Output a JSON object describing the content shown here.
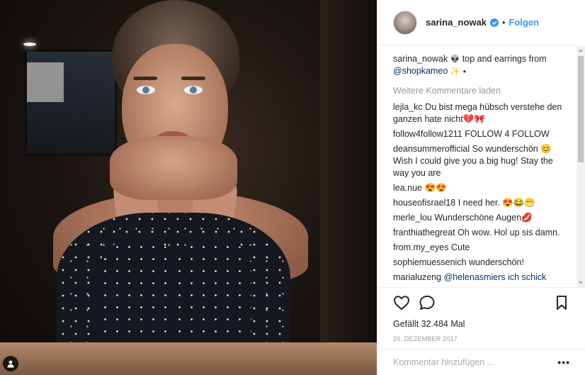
{
  "post": {
    "author": {
      "username": "sarina_nowak",
      "verified": true,
      "follow_label": "Folgen",
      "separator": "•"
    },
    "caption": {
      "username": "sarina_nowak",
      "emoji_alien": "👽",
      "text": " top and earrings from ",
      "mention": "@shopkameo",
      "trailing": " ✨ ⭑"
    },
    "load_more_label": "Weitere Kommentare laden",
    "comments": [
      {
        "username": "lejla_kc",
        "text": " Du bist mega hübsch verstehe den ganzen hate nicht💔🎀"
      },
      {
        "username": "follow4follow1211",
        "text": " FOLLOW 4 FOLLOW"
      },
      {
        "username": "deansummerofficial",
        "text": " So wunderschön 😊 Wish I could give you a big hug! Stay the way you are"
      },
      {
        "username": "lea.nue",
        "text": " 😍😍"
      },
      {
        "username": "houseofisrael18",
        "text": " I need her. 😍😂😁"
      },
      {
        "username": "merle_lou",
        "text": " Wunderschöne Augen💋"
      },
      {
        "username": "franthiathegreat",
        "text": " Oh wow. Hol up sis damn."
      },
      {
        "username": "from.my_eyes",
        "text": " Cute"
      },
      {
        "username": "sophiemuessenich",
        "text": " wunderschön!"
      },
      {
        "username": "marialuzeng",
        "text": " @helenasmiers ich schick"
      }
    ],
    "likes_prefix": "Gefällt ",
    "likes_count": "32.484",
    "likes_suffix": " Mal",
    "date": "26. DEZEMBER 2017",
    "add_comment_placeholder": "Kommentar hinzufügen ...",
    "more_options_label": "•••"
  },
  "colors": {
    "link": "#3897f0",
    "text": "#262626",
    "muted": "#999999",
    "mention": "#003569"
  },
  "icons": [
    "user-tag-icon",
    "verified-badge-icon",
    "heart-icon",
    "comment-icon",
    "bookmark-icon"
  ]
}
